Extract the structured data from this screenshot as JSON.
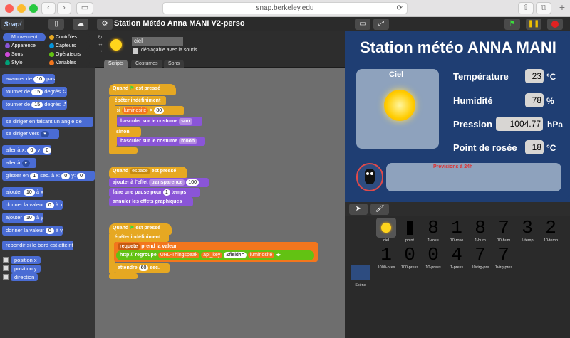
{
  "browser": {
    "url": "snap.berkeley.edu",
    "back": "‹",
    "forward": "›",
    "sidebar": "▭",
    "reload": "⟳",
    "share": "⇧",
    "tabs": "⧉",
    "new_tab": "+"
  },
  "app": {
    "logo": "Snap!",
    "project_title": "Station Météo Anna MANI V2-perso",
    "gear": "⚙",
    "file": "▯",
    "cloud": "☁"
  },
  "categories": [
    {
      "label": "Mouvement",
      "color": "#4a6cd4"
    },
    {
      "label": "Contrôles",
      "color": "#e6a822"
    },
    {
      "label": "Apparence",
      "color": "#8a55d7"
    },
    {
      "label": "Capteurs",
      "color": "#0494dc"
    },
    {
      "label": "Sons",
      "color": "#cf4ad9"
    },
    {
      "label": "Opérateurs",
      "color": "#62c213"
    },
    {
      "label": "Stylo",
      "color": "#00a178"
    },
    {
      "label": "Variables",
      "color": "#f3761d"
    }
  ],
  "palette": {
    "b1_a": "avancer de",
    "b1_n": "10",
    "b1_b": "pas",
    "b2_a": "tourner de",
    "b2_n": "15",
    "b2_b": "degrés ↻",
    "b3_a": "tourner de",
    "b3_n": "15",
    "b3_b": "degrés ↺",
    "b4": "se diriger en faisant un angle de",
    "b5": "se diriger vers",
    "b6_a": "aller à x:",
    "b6_n1": "0",
    "b6_b": "y:",
    "b6_n2": "0",
    "b7": "aller à",
    "b8_a": "glisser en",
    "b8_n": "1",
    "b8_b": "sec. à x:",
    "b8_n2": "0",
    "b8_c": "y:",
    "b8_n3": "0",
    "b9_a": "ajouter",
    "b9_n": "10",
    "b9_b": "à x",
    "b10_a": "donner la valeur",
    "b10_n": "0",
    "b10_b": "à x",
    "b11_a": "ajouter",
    "b11_n": "10",
    "b11_b": "à y",
    "b12_a": "donner la valeur",
    "b12_n": "0",
    "b12_b": "à y",
    "b13": "rebondir si le bord est atteint",
    "r1": "position x",
    "r2": "position y",
    "r3": "direction"
  },
  "sprite": {
    "name": "ciel",
    "draggable_label": "déplaçable avec la souris"
  },
  "tabs": {
    "scripts": "Scripts",
    "costumes": "Costumes",
    "sons": "Sons"
  },
  "script1": {
    "hat": "Quand",
    "hat2": "est pressé",
    "forever": "répéter indéfiniment",
    "if": "si",
    "var": "luminosité",
    ">": ">",
    "num": "80",
    "sw1": "basculer sur le costume",
    "sun": "sun",
    "else": "sinon",
    "sw2": "basculer sur le costume",
    "moon": "moon"
  },
  "script2": {
    "hat": "Quand",
    "key": "espace",
    "hat2": "est pressé",
    "fx": "ajouter à l'effet",
    "fxn": "transparence",
    "fxv": "100",
    "wait": "faire une pause pour",
    "waitv": "1",
    "waitu": "temps",
    "clear": "annuler les effets graphiques"
  },
  "script3": {
    "hat": "Quand",
    "hat2": "est pressé",
    "forever": "répéter indéfiniment",
    "requete": "requete",
    "get": "prend la valeur",
    "url": "http://",
    "join": "regroupe",
    "url2": "URL-Thingspeak",
    "key": "api_key",
    "field": "&field4=",
    "lum": "luminosité",
    "wait": "attendre",
    "waitv": "60",
    "waitu": "sec."
  },
  "stage": {
    "title": "Station météo ANNA MANI",
    "ciel": "Ciel",
    "rows": [
      {
        "label": "Température",
        "value": "23",
        "unit": "°C"
      },
      {
        "label": "Humidité",
        "value": "78",
        "unit": "%"
      },
      {
        "label": "Pression",
        "value": "1004.77",
        "unit": "hPa"
      },
      {
        "label": "Point de rosée",
        "value": "18",
        "unit": "°C"
      }
    ],
    "forecast": "Prévisions à 24h"
  },
  "corral": {
    "costumes": [
      {
        "glyph": "",
        "label": "ciel"
      },
      {
        "glyph": "",
        "label": "point"
      },
      {
        "glyph": "8",
        "label": "1-rose"
      },
      {
        "glyph": "1",
        "label": "10-rose"
      },
      {
        "glyph": "8",
        "label": "1-hum"
      },
      {
        "glyph": "7",
        "label": "10-hum"
      },
      {
        "glyph": "3",
        "label": "1-temp"
      },
      {
        "glyph": "2",
        "label": "10-temp"
      },
      {
        "glyph": "1",
        "label": "1000-pres"
      },
      {
        "glyph": "0",
        "label": "100-press"
      },
      {
        "glyph": "0",
        "label": "10-press"
      },
      {
        "glyph": "4",
        "label": "1-press"
      },
      {
        "glyph": "7",
        "label": "10virg-pre"
      },
      {
        "glyph": "7",
        "label": "1virg-pres"
      }
    ],
    "scene": "Scène"
  }
}
